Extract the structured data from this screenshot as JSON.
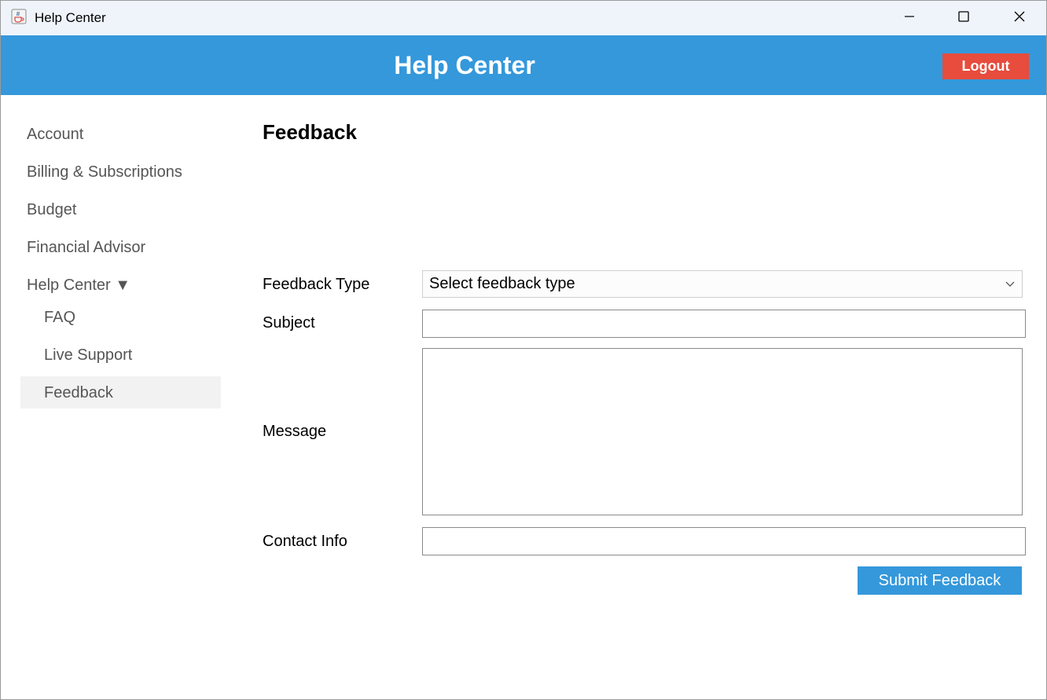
{
  "window": {
    "title": "Help Center"
  },
  "header": {
    "title": "Help Center",
    "logout_label": "Logout"
  },
  "sidebar": {
    "items": [
      {
        "label": "Account"
      },
      {
        "label": "Billing & Subscriptions"
      },
      {
        "label": "Budget"
      },
      {
        "label": "Financial Advisor"
      },
      {
        "label": "Help Center ▼",
        "expanded": true
      }
    ],
    "sub_items": [
      {
        "label": "FAQ"
      },
      {
        "label": "Live Support"
      },
      {
        "label": "Feedback",
        "selected": true
      }
    ]
  },
  "main": {
    "page_title": "Feedback",
    "form": {
      "feedback_type_label": "Feedback Type",
      "feedback_type_value": "Select feedback type",
      "subject_label": "Subject",
      "subject_value": "",
      "message_label": "Message",
      "message_value": "",
      "contact_label": "Contact Info",
      "contact_value": "",
      "submit_label": "Submit Feedback"
    }
  },
  "colors": {
    "header_bg": "#3498db",
    "logout_bg": "#e74c3c",
    "submit_bg": "#3498db",
    "selected_nav_bg": "#f2f2f2"
  },
  "icons": {
    "app": "java-cup-icon",
    "minimize": "minimize-icon",
    "maximize": "maximize-icon",
    "close": "close-icon",
    "dropdown": "chevron-down-icon"
  }
}
